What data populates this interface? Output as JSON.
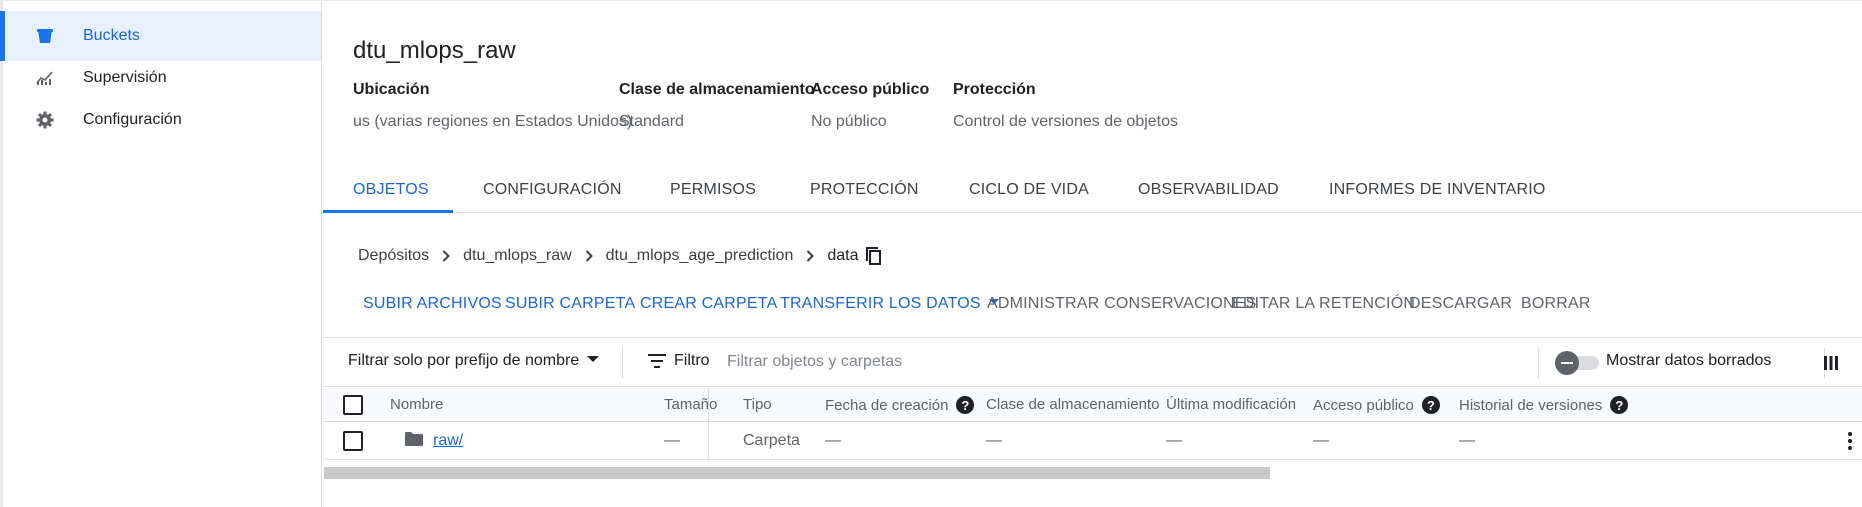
{
  "sidebar": {
    "items": [
      {
        "label": "Buckets",
        "icon": "bucket-icon",
        "active": true
      },
      {
        "label": "Supervisión",
        "icon": "monitoring-icon",
        "active": false
      },
      {
        "label": "Configuración",
        "icon": "gear-icon",
        "active": false
      }
    ]
  },
  "bucket": {
    "title": "dtu_mlops_raw",
    "properties": [
      {
        "label": "Ubicación",
        "value": "us (varias regiones en Estados Unidos)"
      },
      {
        "label": "Clase de almacenamiento",
        "value": "Standard"
      },
      {
        "label": "Acceso público",
        "value": "No público"
      },
      {
        "label": "Protección",
        "value": "Control de versiones de objetos"
      }
    ]
  },
  "tabs": [
    {
      "label": "OBJETOS",
      "active": true
    },
    {
      "label": "CONFIGURACIÓN",
      "active": false
    },
    {
      "label": "PERMISOS",
      "active": false
    },
    {
      "label": "PROTECCIÓN",
      "active": false
    },
    {
      "label": "CICLO DE VIDA",
      "active": false
    },
    {
      "label": "OBSERVABILIDAD",
      "active": false
    },
    {
      "label": "INFORMES DE INVENTARIO",
      "active": false
    }
  ],
  "breadcrumb": {
    "items": [
      "Depósitos",
      "dtu_mlops_raw",
      "dtu_mlops_age_prediction"
    ],
    "current": "data"
  },
  "actions": {
    "upload_files": "SUBIR ARCHIVOS",
    "upload_folder": "SUBIR CARPETA",
    "create_folder": "CREAR CARPETA",
    "transfer_data": "TRANSFERIR LOS DATOS",
    "manage_holds": "ADMINISTRAR CONSERVACIONES",
    "edit_retention": "EDITAR LA RETENCIÓN",
    "download": "DESCARGAR",
    "delete": "BORRAR"
  },
  "filter": {
    "prefix_label": "Filtrar solo por prefijo de nombre",
    "filter_label": "Filtro",
    "placeholder": "Filtrar objetos y carpetas",
    "show_deleted_label": "Mostrar datos borrados",
    "show_deleted_enabled": false
  },
  "table": {
    "columns": [
      "Nombre",
      "Tamaño",
      "Tipo",
      "Fecha de creación",
      "Clase de almacenamiento",
      "Última modificación",
      "Acceso público",
      "Historial de versiones"
    ],
    "rows": [
      {
        "name": "raw/",
        "size": "—",
        "type": "Carpeta",
        "created": "—",
        "storage_class": "—",
        "modified": "—",
        "public_access": "—",
        "version_history": "—"
      }
    ]
  },
  "colors": {
    "accent": "#1a73e8",
    "accent_text": "#1967d2",
    "active_bg": "#e8f0fe"
  }
}
